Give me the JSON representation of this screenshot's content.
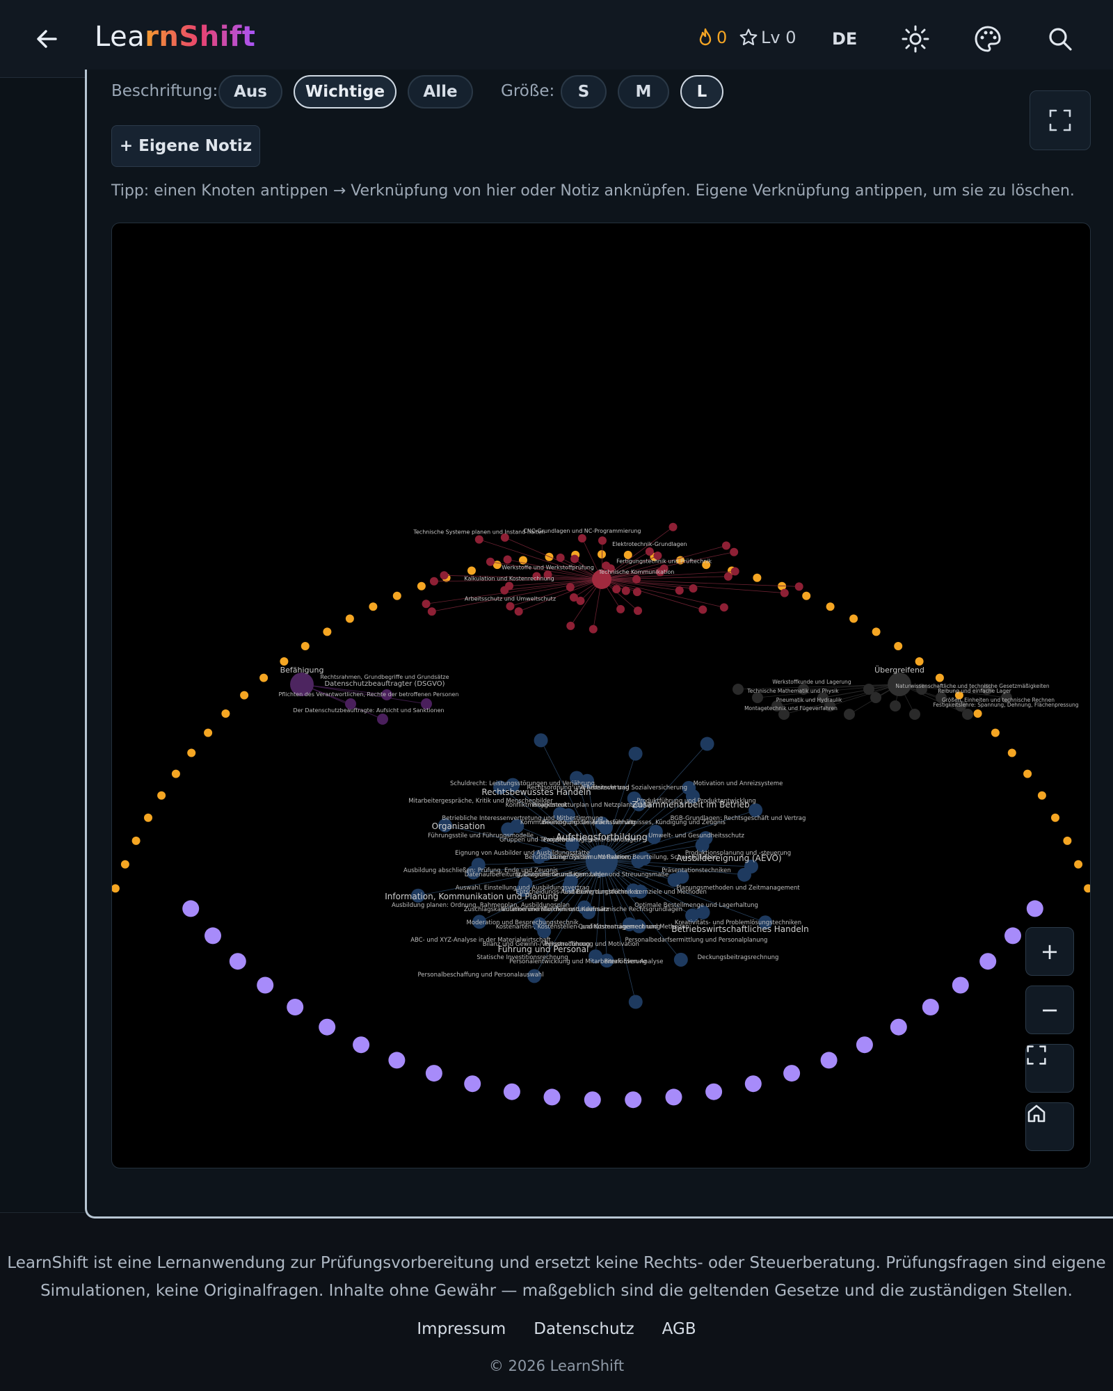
{
  "header": {
    "brand_a": "Lea",
    "brand_b": "rnShift",
    "streak": "0",
    "level": "Lv 0",
    "language": "DE",
    "icons": [
      "arrow-left-icon",
      "flame-icon",
      "star-icon",
      "sun-icon",
      "palette-icon",
      "search-icon"
    ]
  },
  "controls": {
    "labels_title": "Beschriftung:",
    "labels_options": [
      "Aus",
      "Wichtige",
      "Alle"
    ],
    "labels_selected": "Wichtige",
    "size_title": "Größe:",
    "size_options": [
      "S",
      "M",
      "L"
    ],
    "size_selected": "L",
    "note_button": "+ Eigene Notiz",
    "tip": "Tipp: einen Knoten antippen → Verknüpfung von hier oder Notiz anknüpfen. Eigene Verknüpfung antippen, um sie zu löschen."
  },
  "graph": {
    "colors": {
      "orange": "#f5a623",
      "purple_ring": "#a78bfa",
      "red_cluster": "#8e2035",
      "blue_cluster": "#1e3a5f",
      "violet_cluster": "#4a1f5c",
      "gray_cluster": "#2a2a2a"
    },
    "cluster_labels": {
      "red": [
        "Technische Kommunikation",
        "Fertigungstechnik und Prüftechnik",
        "Elektrotechnik-Grundlagen",
        "CNC-Grundlagen und NC-Programmierung",
        "Technische Systeme planen und Instand halten",
        "Werkstoffe und Werkstoffprüfung",
        "Kalkulation und Kostenrechnung",
        "Arbeitsschutz und Umweltschutz"
      ],
      "violet_title": "Befähigung",
      "violet": [
        "Rechtsrahmen, Grundbegriffe und Grundsätze",
        "Datenschutzbeauftragter (DSGVO)",
        "Pflichten des Verantwortlichen, Rechte der betroffenen Personen",
        "Der Datenschutzbeauftragte: Aufsicht und Sanktionen"
      ],
      "gray_title": "Übergreifend",
      "gray": [
        "Werkstoffkunde und Lagerung",
        "Technische Mathematik und Physik",
        "Pneumatik und Hydraulik",
        "Montagetechnik und Fügeverfahren",
        "Naturwissenschaftliche und technische Gesetzmäßigkeiten",
        "Reibung und einfache Lager",
        "Festigkeitslehre: Spannung, Dehnung, Flächenpressung",
        "Größen, Einheiten und technische Rechnen"
      ],
      "blue_center": "Aufstiegsfortbildung",
      "blue_major": [
        "Rechtsbewusstes Handeln",
        "Zusammenarbeit im Betrieb",
        "Organisation",
        "Information, Kommunikation und Planung",
        "Ausbildereignung (AEVO)",
        "Betriebswirtschaftliches Handeln",
        "Führung und Personal"
      ],
      "blue_minor": [
        "Schuldrecht: Leistungsstörungen und Verjährung",
        "Arbeitsrecht und Sozialversicherung",
        "Motivation und Anreizsysteme",
        "Rechtsordnung und Arbeitsvertrag",
        "Mitarbeitergespräche, Kritik und Menschenbilder",
        "Projektstrukturplan und Netzplantechnik",
        "Produktführung und Produktentwicklung",
        "Konfliktmanagement",
        "Betriebliche Interessenvertretung und Mitbestimmung",
        "Beendigung des Arbeitsverhältnisses, Kündigung und Zeugnis",
        "BGB-Grundlagen: Rechtsgeschäft und Vertrag",
        "Kommunikation und Gesprächsführung",
        "Führungsstile und Führungsmodelle",
        "Projektmanagement-Grundlagen",
        "Umwelt- und Gesundheitsschutz",
        "Gruppen und Teamarbeit",
        "Eignung von Ausbilder und Ausbildungsstätte",
        "Lernen fördern: Motivation, Beurteilung, Schwierigkeiten",
        "Produktionsplanung und -steuerung",
        "Berufsbildung: System und Rahmen",
        "Ausbildung abschließen: Prüfung, Ende und Zeugnis",
        "Statistische Grundlagen: Lage- und Streuungsmaße",
        "Präsentationstechniken",
        "Datenaufbereitung, Diagramme und Kennzahlen",
        "Auswahl, Einstellung und Ausbildungsvertrag",
        "Ausbildung durchführen: Lernziele und Methoden",
        "Planungsmethoden und Zeitmanagement",
        "Entscheidungs- und Bewertungstechniken",
        "Ausbildung planen: Ordnung, Rahmenplan, Ausbildungsplan",
        "Unternehmensformen und Kaufmännische Rechtsgrundlagen",
        "Optimale Bestellmenge und Lagerhaltung",
        "Zuschlagskalkulation und Maschinenstundensatz",
        "Moderation und Besprechungstechnik",
        "Qualitätsmanagement und Methoden",
        "Kreativitäts- und Problemlösungstechniken",
        "Kostenarten-, Kostenstellen- und Kostenträgerrechnung",
        "ABC- und XYZ-Analyse in der Materialwirtschaft",
        "Personalführung und Motivation",
        "Personalbedarfsermittlung und Personalplanung",
        "Bilanz und Gewinn-/Verlustrechnung",
        "Statische Investitionsrechnung",
        "Break-Even-Analyse",
        "Deckungsbeitragsrechnung",
        "Personalentwicklung und Mitarbeiterförderung",
        "Personalbeschaffung und Personalauswahl"
      ]
    }
  },
  "zoom_controls": {
    "zoom_in": "+",
    "zoom_out": "−"
  },
  "footer": {
    "line1": "LearnShift ist eine Lernanwendung zur Prüfungsvorbereitung und ersetzt keine Rechts- oder Steuerberatung. Prüfungsfragen sind eigene",
    "line2": "Simulationen, keine Originalfragen. Inhalte ohne Gewähr — maßgeblich sind die geltenden Gesetze und die zuständigen Stellen.",
    "links": [
      "Impressum",
      "Datenschutz",
      "AGB"
    ],
    "copyright": "© 2026 LearnShift"
  }
}
